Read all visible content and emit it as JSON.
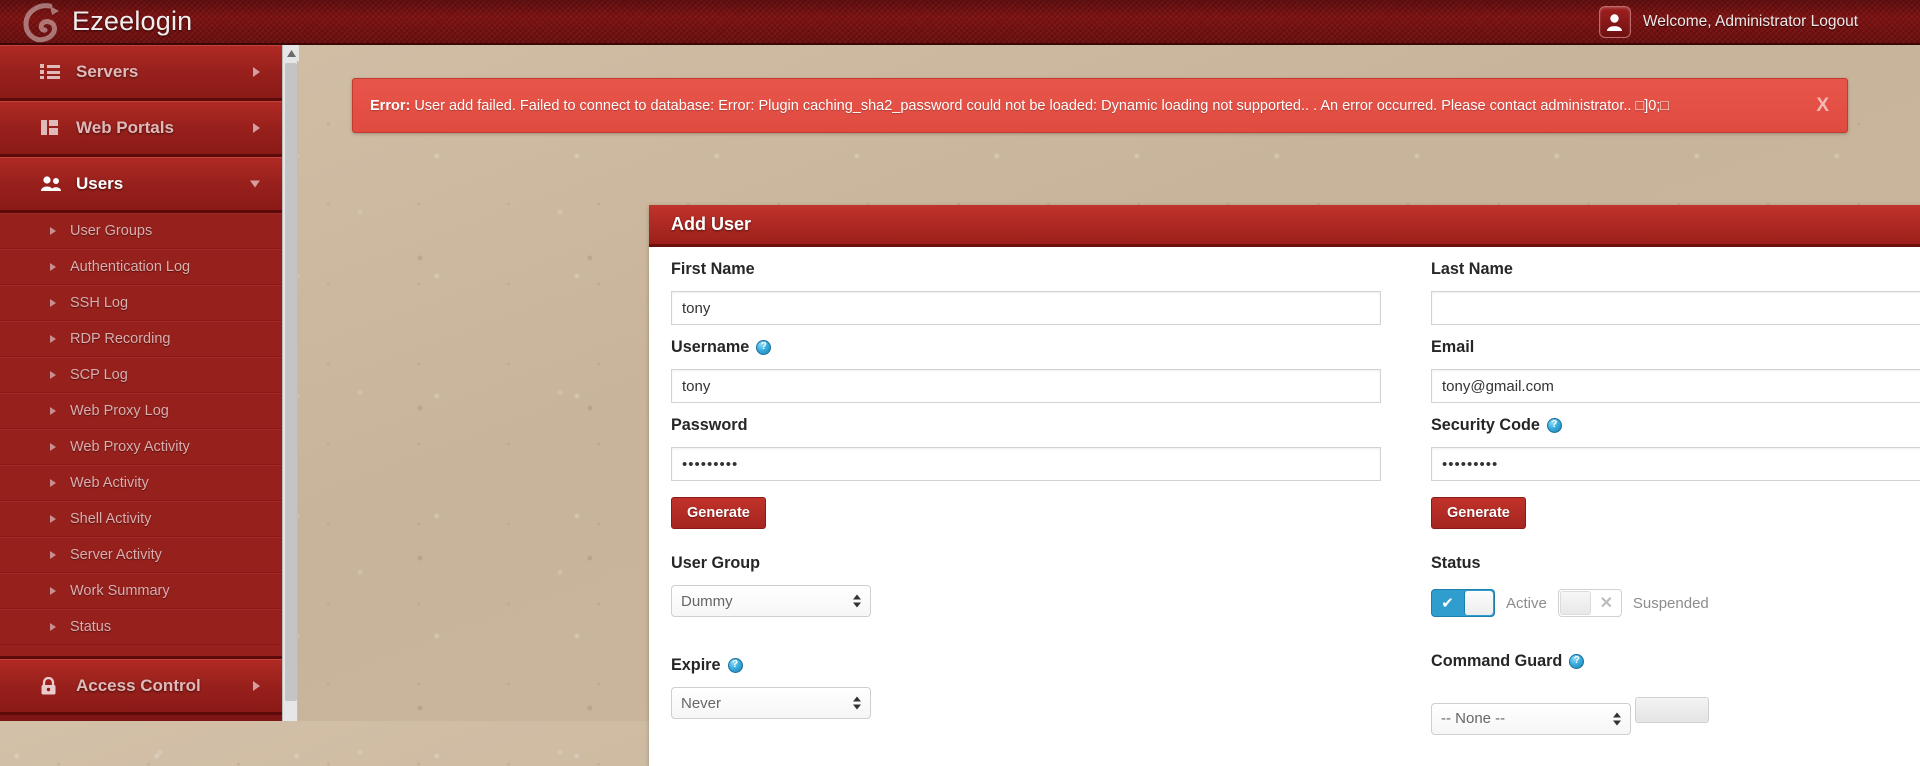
{
  "topbar": {
    "brand": "Ezeelogin",
    "welcome": "Welcome, Administrator Logout",
    "avatar_icon": "user-avatar-icon",
    "logo_icon": "ezeelogin-logo-icon"
  },
  "sidebar": {
    "top_items": [
      {
        "label": "Servers",
        "icon": "list-icon",
        "expanded": false,
        "active": false
      },
      {
        "label": "Web Portals",
        "icon": "grid-icon",
        "expanded": false,
        "active": false
      },
      {
        "label": "Users",
        "icon": "people-icon",
        "expanded": true,
        "active": true
      }
    ],
    "sub_items": [
      {
        "label": "User Groups"
      },
      {
        "label": "Authentication Log"
      },
      {
        "label": "SSH Log"
      },
      {
        "label": "RDP Recording"
      },
      {
        "label": "SCP Log"
      },
      {
        "label": "Web Proxy Log"
      },
      {
        "label": "Web Proxy Activity"
      },
      {
        "label": "Web Activity"
      },
      {
        "label": "Shell Activity"
      },
      {
        "label": "Server Activity"
      },
      {
        "label": "Work Summary"
      },
      {
        "label": "Status"
      }
    ],
    "bottom_items": [
      {
        "label": "Access Control",
        "icon": "lock-icon",
        "expanded": false
      }
    ]
  },
  "alert": {
    "prefix": "Error:",
    "message": " User add failed. Failed to connect to database: Error: Plugin caching_sha2_password could not be loaded: Dynamic loading not supported.. . An error occurred. Please contact administrator.. □]0;□",
    "close_label": "X",
    "color": "#e04b40"
  },
  "panel": {
    "title": "Add User",
    "collapse_icon": "chevron-down-icon",
    "fields": {
      "first_name": {
        "label": "First Name",
        "value": "tony",
        "placeholder": ""
      },
      "last_name": {
        "label": "Last Name",
        "value": "",
        "placeholder": ""
      },
      "username": {
        "label": "Username",
        "value": "tony",
        "placeholder": "",
        "help": "?"
      },
      "email": {
        "label": "Email",
        "value": "tony@gmail.com",
        "placeholder": ""
      },
      "password": {
        "label": "Password",
        "value": "•••••••••",
        "placeholder": ""
      },
      "security_code": {
        "label": "Security Code",
        "value": "•••••••••",
        "placeholder": "",
        "help": "?"
      },
      "user_group": {
        "label": "User Group",
        "value": "Dummy",
        "options": [
          "Dummy"
        ]
      },
      "expire": {
        "label": "Expire",
        "value": "Never",
        "options": [
          "Never"
        ],
        "help": "?"
      },
      "command_guard": {
        "label": "Command Guard",
        "value": "-- None --",
        "options": [
          "-- None --"
        ],
        "help": "?"
      }
    },
    "generate_password_label": "Generate",
    "generate_code_label": "Generate",
    "status": {
      "label": "Status",
      "active_label": "Active",
      "suspended_label": "Suspended",
      "active_on": true,
      "suspended_on": false,
      "on_color": "#2f9dcd"
    }
  }
}
